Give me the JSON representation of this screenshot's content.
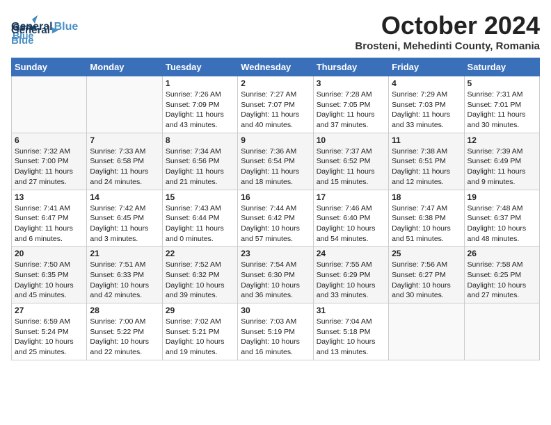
{
  "header": {
    "logo_line1": "General",
    "logo_line2": "Blue",
    "month": "October 2024",
    "location": "Brosteni, Mehedinti County, Romania"
  },
  "weekdays": [
    "Sunday",
    "Monday",
    "Tuesday",
    "Wednesday",
    "Thursday",
    "Friday",
    "Saturday"
  ],
  "weeks": [
    [
      {
        "day": "",
        "info": ""
      },
      {
        "day": "",
        "info": ""
      },
      {
        "day": "1",
        "info": "Sunrise: 7:26 AM\nSunset: 7:09 PM\nDaylight: 11 hours and 43 minutes."
      },
      {
        "day": "2",
        "info": "Sunrise: 7:27 AM\nSunset: 7:07 PM\nDaylight: 11 hours and 40 minutes."
      },
      {
        "day": "3",
        "info": "Sunrise: 7:28 AM\nSunset: 7:05 PM\nDaylight: 11 hours and 37 minutes."
      },
      {
        "day": "4",
        "info": "Sunrise: 7:29 AM\nSunset: 7:03 PM\nDaylight: 11 hours and 33 minutes."
      },
      {
        "day": "5",
        "info": "Sunrise: 7:31 AM\nSunset: 7:01 PM\nDaylight: 11 hours and 30 minutes."
      }
    ],
    [
      {
        "day": "6",
        "info": "Sunrise: 7:32 AM\nSunset: 7:00 PM\nDaylight: 11 hours and 27 minutes."
      },
      {
        "day": "7",
        "info": "Sunrise: 7:33 AM\nSunset: 6:58 PM\nDaylight: 11 hours and 24 minutes."
      },
      {
        "day": "8",
        "info": "Sunrise: 7:34 AM\nSunset: 6:56 PM\nDaylight: 11 hours and 21 minutes."
      },
      {
        "day": "9",
        "info": "Sunrise: 7:36 AM\nSunset: 6:54 PM\nDaylight: 11 hours and 18 minutes."
      },
      {
        "day": "10",
        "info": "Sunrise: 7:37 AM\nSunset: 6:52 PM\nDaylight: 11 hours and 15 minutes."
      },
      {
        "day": "11",
        "info": "Sunrise: 7:38 AM\nSunset: 6:51 PM\nDaylight: 11 hours and 12 minutes."
      },
      {
        "day": "12",
        "info": "Sunrise: 7:39 AM\nSunset: 6:49 PM\nDaylight: 11 hours and 9 minutes."
      }
    ],
    [
      {
        "day": "13",
        "info": "Sunrise: 7:41 AM\nSunset: 6:47 PM\nDaylight: 11 hours and 6 minutes."
      },
      {
        "day": "14",
        "info": "Sunrise: 7:42 AM\nSunset: 6:45 PM\nDaylight: 11 hours and 3 minutes."
      },
      {
        "day": "15",
        "info": "Sunrise: 7:43 AM\nSunset: 6:44 PM\nDaylight: 11 hours and 0 minutes."
      },
      {
        "day": "16",
        "info": "Sunrise: 7:44 AM\nSunset: 6:42 PM\nDaylight: 10 hours and 57 minutes."
      },
      {
        "day": "17",
        "info": "Sunrise: 7:46 AM\nSunset: 6:40 PM\nDaylight: 10 hours and 54 minutes."
      },
      {
        "day": "18",
        "info": "Sunrise: 7:47 AM\nSunset: 6:38 PM\nDaylight: 10 hours and 51 minutes."
      },
      {
        "day": "19",
        "info": "Sunrise: 7:48 AM\nSunset: 6:37 PM\nDaylight: 10 hours and 48 minutes."
      }
    ],
    [
      {
        "day": "20",
        "info": "Sunrise: 7:50 AM\nSunset: 6:35 PM\nDaylight: 10 hours and 45 minutes."
      },
      {
        "day": "21",
        "info": "Sunrise: 7:51 AM\nSunset: 6:33 PM\nDaylight: 10 hours and 42 minutes."
      },
      {
        "day": "22",
        "info": "Sunrise: 7:52 AM\nSunset: 6:32 PM\nDaylight: 10 hours and 39 minutes."
      },
      {
        "day": "23",
        "info": "Sunrise: 7:54 AM\nSunset: 6:30 PM\nDaylight: 10 hours and 36 minutes."
      },
      {
        "day": "24",
        "info": "Sunrise: 7:55 AM\nSunset: 6:29 PM\nDaylight: 10 hours and 33 minutes."
      },
      {
        "day": "25",
        "info": "Sunrise: 7:56 AM\nSunset: 6:27 PM\nDaylight: 10 hours and 30 minutes."
      },
      {
        "day": "26",
        "info": "Sunrise: 7:58 AM\nSunset: 6:25 PM\nDaylight: 10 hours and 27 minutes."
      }
    ],
    [
      {
        "day": "27",
        "info": "Sunrise: 6:59 AM\nSunset: 5:24 PM\nDaylight: 10 hours and 25 minutes."
      },
      {
        "day": "28",
        "info": "Sunrise: 7:00 AM\nSunset: 5:22 PM\nDaylight: 10 hours and 22 minutes."
      },
      {
        "day": "29",
        "info": "Sunrise: 7:02 AM\nSunset: 5:21 PM\nDaylight: 10 hours and 19 minutes."
      },
      {
        "day": "30",
        "info": "Sunrise: 7:03 AM\nSunset: 5:19 PM\nDaylight: 10 hours and 16 minutes."
      },
      {
        "day": "31",
        "info": "Sunrise: 7:04 AM\nSunset: 5:18 PM\nDaylight: 10 hours and 13 minutes."
      },
      {
        "day": "",
        "info": ""
      },
      {
        "day": "",
        "info": ""
      }
    ]
  ]
}
